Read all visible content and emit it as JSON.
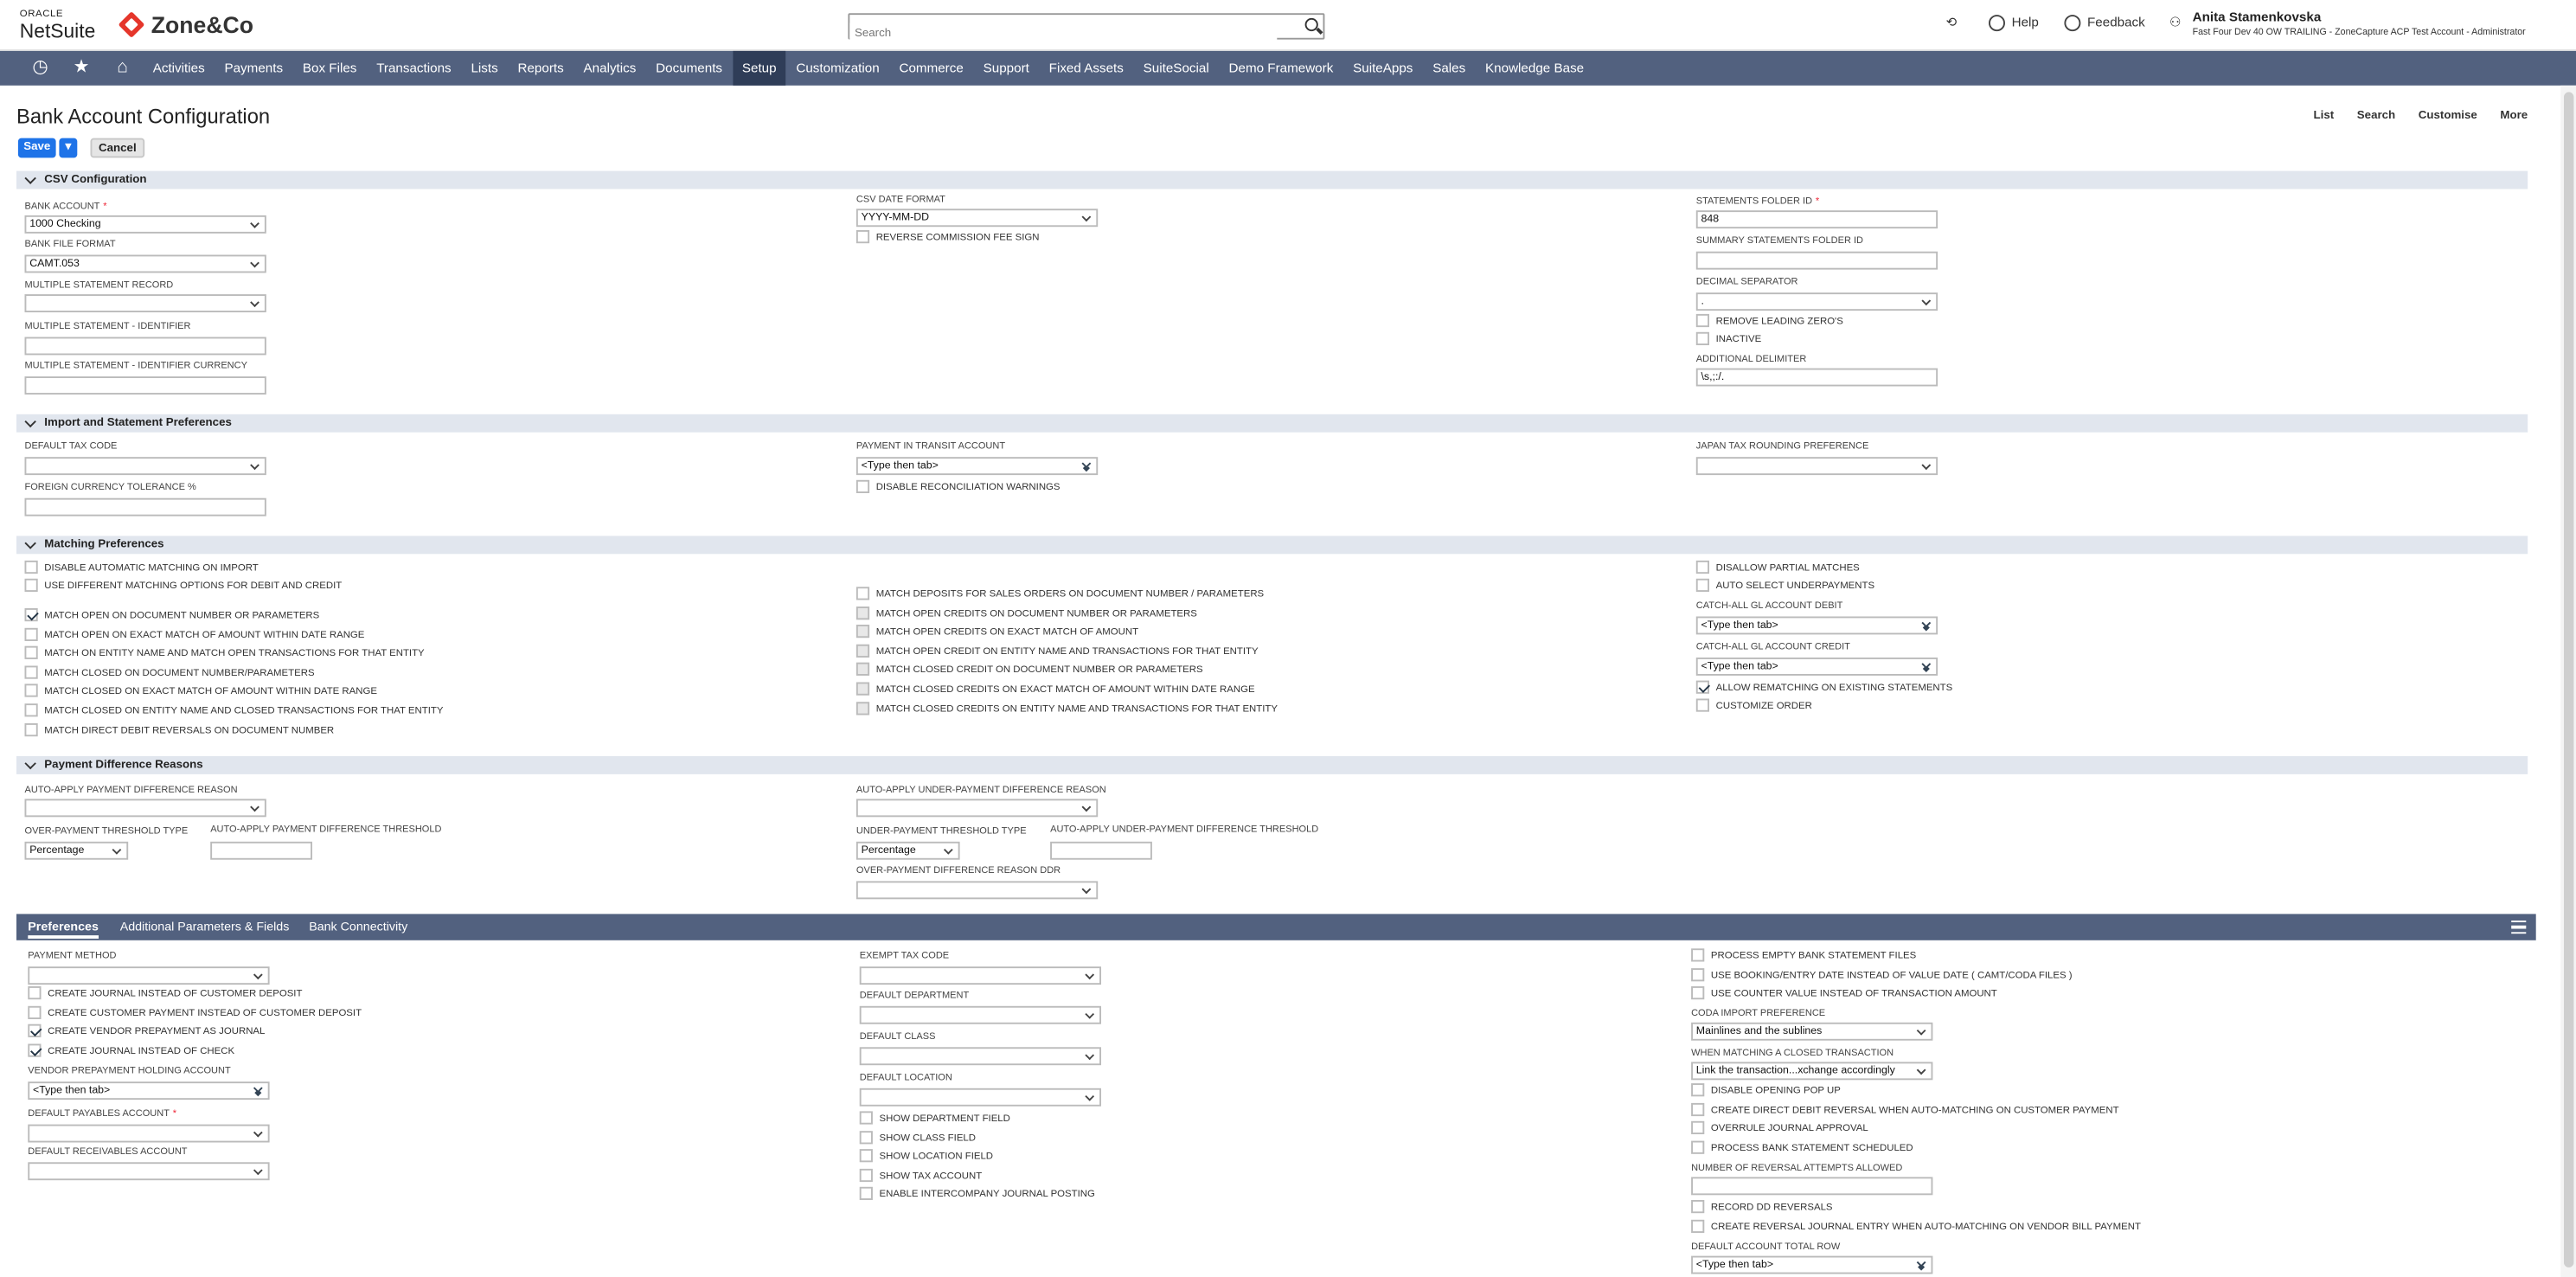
{
  "header": {
    "oracle": "ORACLE",
    "netsuite": "NetSuite",
    "brand": "Zone&Co",
    "search_placeholder": "Search",
    "help": "Help",
    "feedback": "Feedback",
    "user_name": "Anita Stamenkovska",
    "user_account": "Fast Four Dev 40 OW TRAILING - ZoneCapture ACP Test Account - Administrator"
  },
  "nav": [
    "Activities",
    "Payments",
    "Box Files",
    "Transactions",
    "Lists",
    "Reports",
    "Analytics",
    "Documents",
    "Setup",
    "Customization",
    "Commerce",
    "Support",
    "Fixed Assets",
    "SuiteSocial",
    "Demo Framework",
    "SuiteApps",
    "Sales",
    "Knowledge Base"
  ],
  "page": {
    "title": "Bank Account Configuration",
    "links": [
      "List",
      "Search",
      "Customise",
      "More"
    ],
    "save": "Save",
    "cancel": "Cancel"
  },
  "sections": {
    "csv": "CSV Configuration",
    "import": "Import and Statement Preferences",
    "matching": "Matching Preferences",
    "diff": "Payment Difference Reasons"
  },
  "csv": {
    "bank_account": "BANK ACCOUNT",
    "bank_account_val": "1000 Checking",
    "bank_file_format": "BANK FILE FORMAT",
    "bank_file_format_val": "CAMT.053",
    "msr": "MULTIPLE STATEMENT RECORD",
    "ms_identifier": "MULTIPLE STATEMENT - IDENTIFIER",
    "ms_identifier_cur": "MULTIPLE STATEMENT - IDENTIFIER CURRENCY",
    "csv_date_format": "CSV DATE FORMAT",
    "csv_date_val": "YYYY-MM-DD",
    "reverse_fee": "REVERSE COMMISSION FEE SIGN",
    "stmt_folder": "STATEMENTS FOLDER ID",
    "stmt_folder_val": "848",
    "summary_folder": "SUMMARY STATEMENTS FOLDER ID",
    "decimal_sep": "DECIMAL SEPARATOR",
    "decimal_val": ".",
    "remove_zero": "REMOVE LEADING ZERO'S",
    "inactive": "INACTIVE",
    "add_delim": "ADDITIONAL DELIMITER",
    "add_delim_val": "\\s,;:/."
  },
  "import": {
    "tax_code": "DEFAULT TAX CODE",
    "fx_tol": "FOREIGN CURRENCY TOLERANCE %",
    "pit_account": "PAYMENT IN TRANSIT ACCOUNT",
    "type_tab": "<Type then tab>",
    "disable_recon": "DISABLE RECONCILIATION WARNINGS",
    "japan_tax": "JAPAN TAX ROUNDING PREFERENCE"
  },
  "matching": {
    "col1": [
      "DISABLE AUTOMATIC MATCHING ON IMPORT",
      "USE DIFFERENT MATCHING OPTIONS FOR DEBIT AND CREDIT",
      "MATCH OPEN ON DOCUMENT NUMBER OR PARAMETERS",
      "MATCH OPEN ON EXACT MATCH OF AMOUNT WITHIN DATE RANGE",
      "MATCH ON ENTITY NAME AND MATCH OPEN TRANSACTIONS FOR THAT ENTITY",
      "MATCH CLOSED ON DOCUMENT NUMBER/PARAMETERS",
      "MATCH CLOSED ON EXACT MATCH OF AMOUNT WITHIN DATE RANGE",
      "MATCH CLOSED ON ENTITY NAME AND CLOSED TRANSACTIONS FOR THAT ENTITY",
      "MATCH DIRECT DEBIT REVERSALS ON DOCUMENT NUMBER"
    ],
    "col2": [
      "MATCH DEPOSITS FOR SALES ORDERS ON DOCUMENT NUMBER / PARAMETERS",
      "MATCH OPEN CREDITS ON DOCUMENT NUMBER OR PARAMETERS",
      "MATCH OPEN CREDITS ON EXACT MATCH OF AMOUNT",
      "MATCH OPEN CREDIT ON ENTITY NAME AND TRANSACTIONS FOR THAT ENTITY",
      "MATCH CLOSED CREDIT ON DOCUMENT NUMBER OR PARAMETERS",
      "MATCH CLOSED CREDITS ON EXACT MATCH OF AMOUNT WITHIN DATE RANGE",
      "MATCH CLOSED CREDITS ON ENTITY NAME AND TRANSACTIONS FOR THAT ENTITY"
    ],
    "disallow_partial": "DISALLOW PARTIAL MATCHES",
    "auto_under": "AUTO SELECT UNDERPAYMENTS",
    "catch_debit": "CATCH-ALL GL ACCOUNT DEBIT",
    "catch_credit": "CATCH-ALL GL ACCOUNT CREDIT",
    "allow_rematch": "ALLOW REMATCHING ON EXISTING STATEMENTS",
    "customize_order": "CUSTOMIZE ORDER"
  },
  "diff": {
    "auto_apply": "AUTO-APPLY PAYMENT DIFFERENCE REASON",
    "over_type": "OVER-PAYMENT THRESHOLD TYPE",
    "over_type_val": "Percentage",
    "auto_threshold": "AUTO-APPLY PAYMENT DIFFERENCE THRESHOLD",
    "auto_under": "AUTO-APPLY UNDER-PAYMENT DIFFERENCE REASON",
    "under_type": "UNDER-PAYMENT THRESHOLD TYPE",
    "under_type_val": "Percentage",
    "auto_under_thr": "AUTO-APPLY UNDER-PAYMENT DIFFERENCE THRESHOLD",
    "over_ddr": "OVER-PAYMENT DIFFERENCE REASON DDR"
  },
  "subtabs": [
    "Preferences",
    "Additional Parameters & Fields",
    "Bank Connectivity"
  ],
  "prefs": {
    "payment_method": "PAYMENT METHOD",
    "left_cbs": [
      "CREATE JOURNAL INSTEAD OF CUSTOMER DEPOSIT",
      "CREATE CUSTOMER PAYMENT INSTEAD OF CUSTOMER DEPOSIT",
      "CREATE VENDOR PREPAYMENT AS JOURNAL",
      "CREATE JOURNAL INSTEAD OF CHECK"
    ],
    "vendor_prepay": "VENDOR PREPAYMENT HOLDING ACCOUNT",
    "def_payables": "DEFAULT PAYABLES ACCOUNT",
    "def_receivables": "DEFAULT RECEIVABLES ACCOUNT",
    "exempt_tax": "EXEMPT TAX CODE",
    "def_dept": "DEFAULT DEPARTMENT",
    "def_class": "DEFAULT CLASS",
    "def_loc": "DEFAULT LOCATION",
    "mid_cbs": [
      "SHOW DEPARTMENT FIELD",
      "SHOW CLASS FIELD",
      "SHOW LOCATION FIELD",
      "SHOW TAX ACCOUNT",
      "ENABLE INTERCOMPANY JOURNAL POSTING"
    ],
    "right_cbs_top": [
      "PROCESS EMPTY BANK STATEMENT FILES",
      "USE BOOKING/ENTRY DATE INSTEAD OF VALUE DATE ( CAMT/CODA FILES )",
      "USE COUNTER VALUE INSTEAD OF TRANSACTION AMOUNT"
    ],
    "coda_pref": "CODA IMPORT PREFERENCE",
    "coda_val": "Mainlines and the sublines",
    "closed_tx": "WHEN MATCHING A CLOSED TRANSACTION",
    "closed_tx_val": "Link the transaction...xchange accordingly",
    "right_cbs_mid": [
      "DISABLE OPENING POP UP",
      "CREATE DIRECT DEBIT REVERSAL WHEN AUTO-MATCHING ON CUSTOMER PAYMENT",
      "OVERRULE JOURNAL APPROVAL",
      "PROCESS BANK STATEMENT SCHEDULED"
    ],
    "reversal_attempts": "NUMBER OF REVERSAL ATTEMPTS ALLOWED",
    "right_cbs_bot": [
      "RECORD DD REVERSALS",
      "CREATE REVERSAL JOURNAL ENTRY WHEN AUTO-MATCHING ON VENDOR BILL PAYMENT"
    ],
    "def_total_row": "DEFAULT ACCOUNT TOTAL ROW"
  }
}
